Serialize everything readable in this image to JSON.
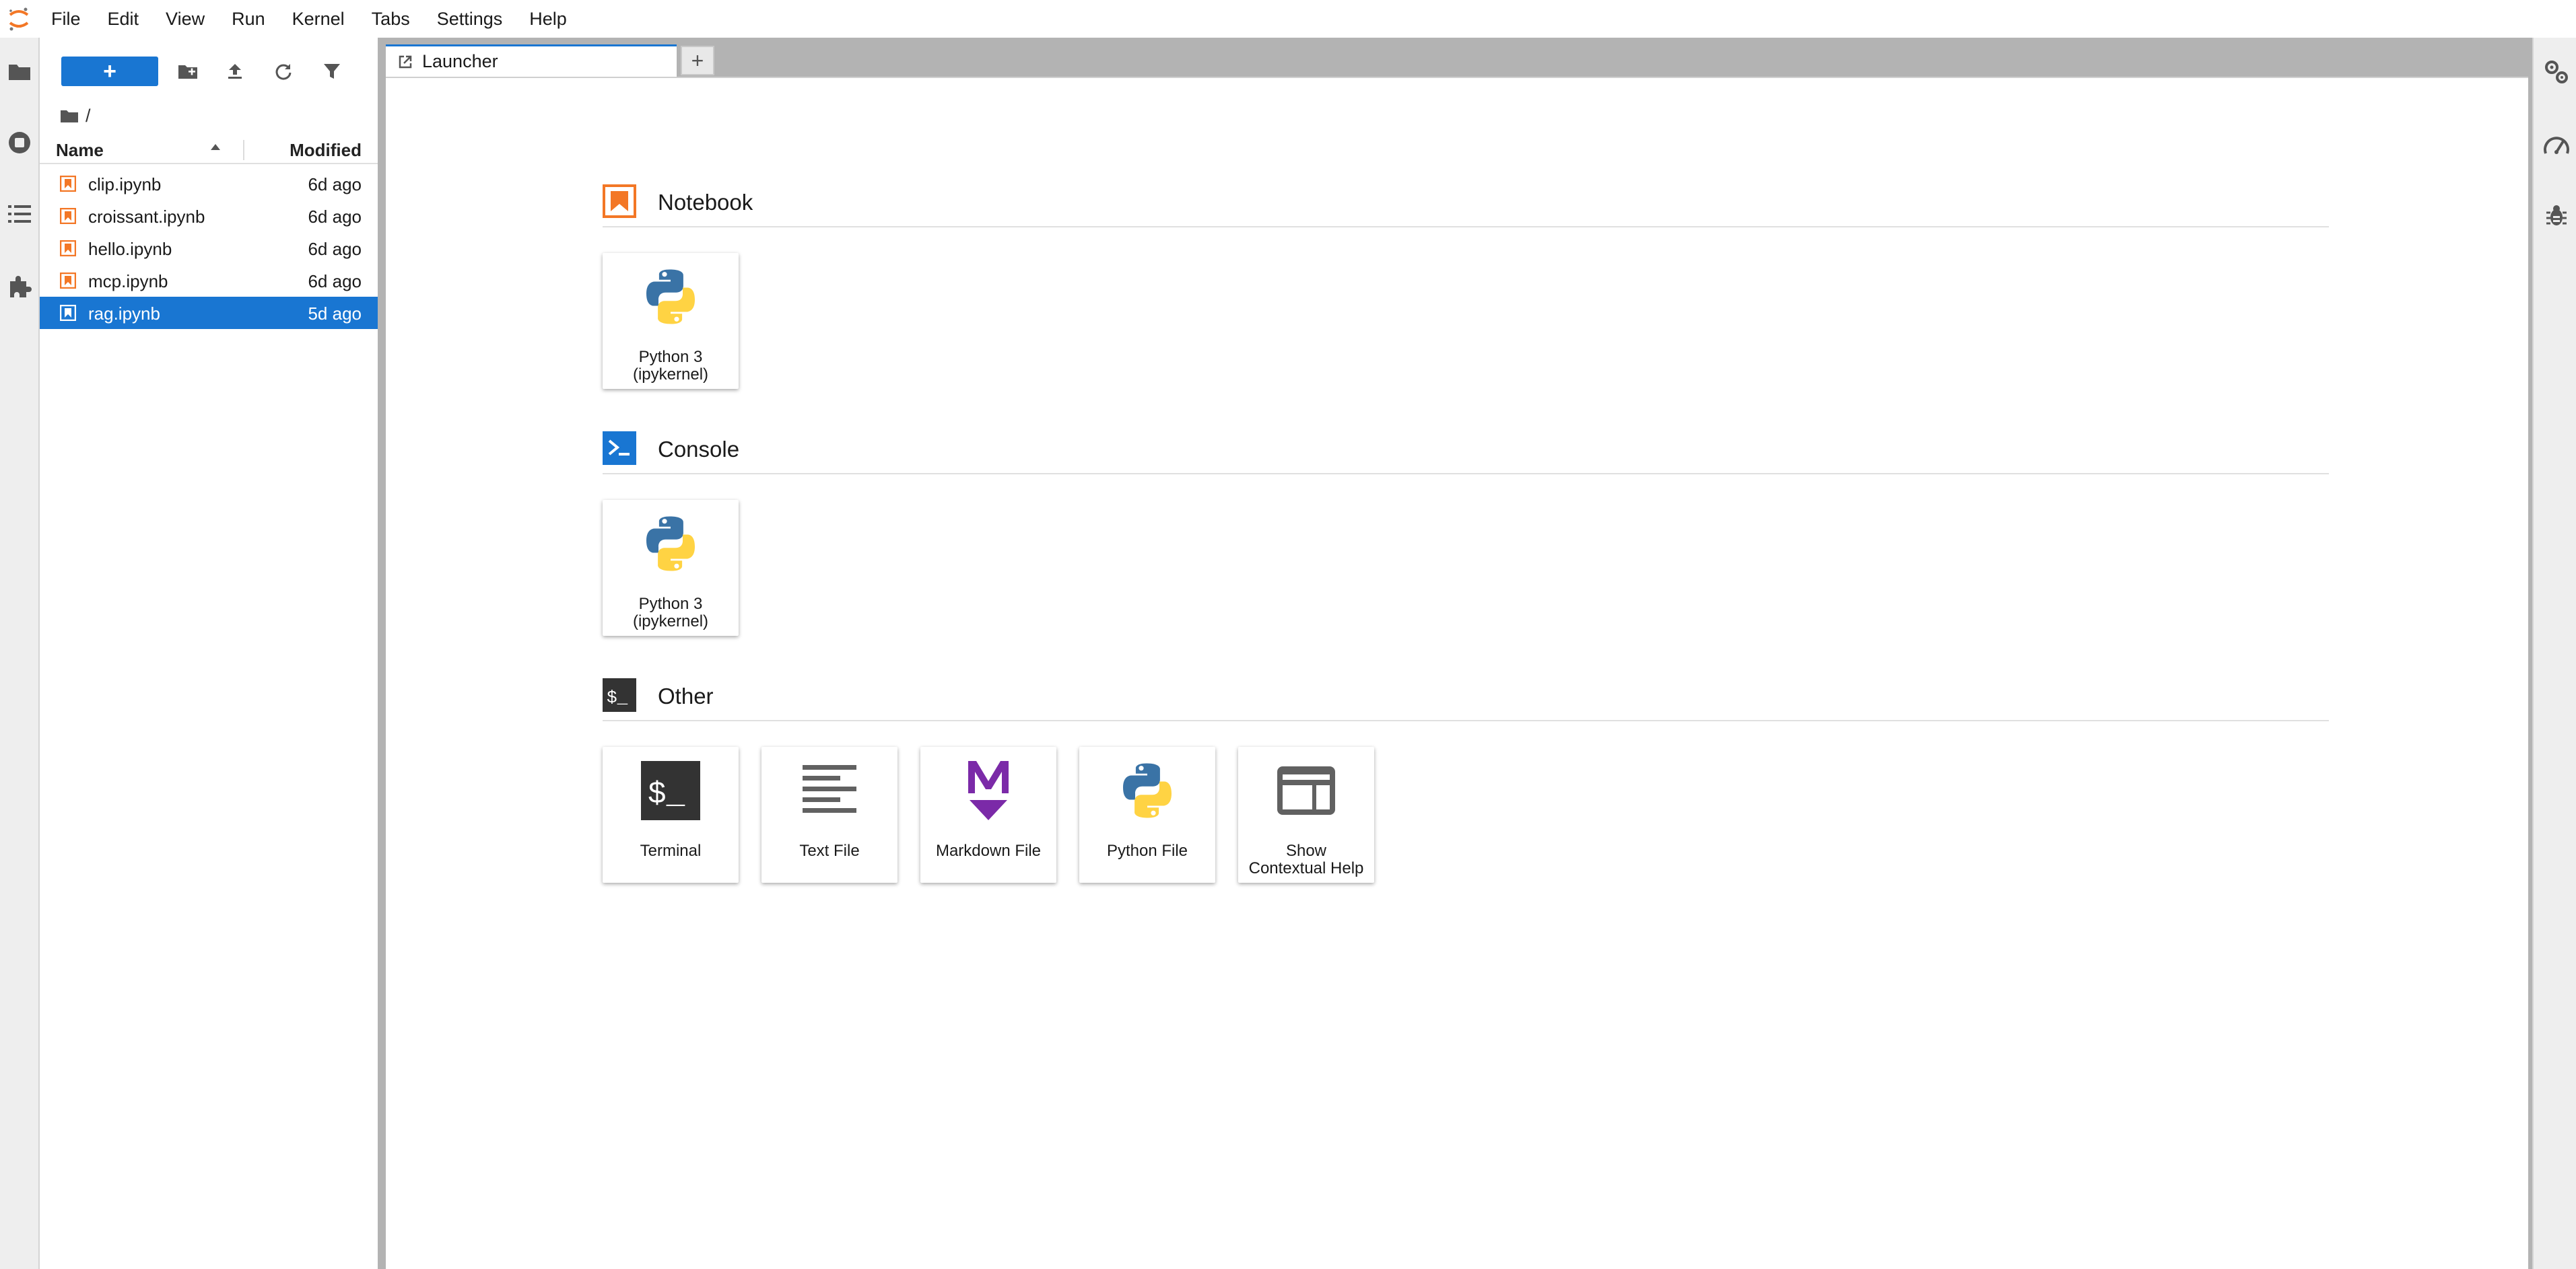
{
  "menubar": {
    "items": [
      "File",
      "Edit",
      "View",
      "Run",
      "Kernel",
      "Tabs",
      "Settings",
      "Help"
    ]
  },
  "left_activity": {
    "icons": [
      "folder-icon",
      "running-sessions-icon",
      "table-of-contents-icon",
      "extensions-icon"
    ]
  },
  "filebrowser": {
    "new_button_label": "+",
    "breadcrumb": "/",
    "columns": {
      "name": "Name",
      "modified": "Modified"
    },
    "files": [
      {
        "name": "clip.ipynb",
        "modified": "6d ago",
        "selected": false
      },
      {
        "name": "croissant.ipynb",
        "modified": "6d ago",
        "selected": false
      },
      {
        "name": "hello.ipynb",
        "modified": "6d ago",
        "selected": false
      },
      {
        "name": "mcp.ipynb",
        "modified": "6d ago",
        "selected": false
      },
      {
        "name": "rag.ipynb",
        "modified": "5d ago",
        "selected": true
      }
    ]
  },
  "tabs": {
    "active_label": "Launcher",
    "add_label": "+"
  },
  "launcher": {
    "sections": [
      {
        "title": "Notebook",
        "cards": [
          {
            "label": "Python 3\n(ipykernel)",
            "icon": "python-icon"
          }
        ]
      },
      {
        "title": "Console",
        "cards": [
          {
            "label": "Python 3\n(ipykernel)",
            "icon": "python-icon"
          }
        ]
      },
      {
        "title": "Other",
        "cards": [
          {
            "label": "Terminal",
            "icon": "terminal-icon"
          },
          {
            "label": "Text File",
            "icon": "text-file-icon"
          },
          {
            "label": "Markdown File",
            "icon": "markdown-icon"
          },
          {
            "label": "Python File",
            "icon": "python-icon"
          },
          {
            "label": "Show\nContextual Help",
            "icon": "contextual-help-icon"
          }
        ]
      }
    ]
  },
  "right_activity": {
    "icons": [
      "property-inspector-icon",
      "resource-usage-icon",
      "debugger-icon"
    ]
  },
  "colors": {
    "accent": "#1976d2",
    "notebook_orange": "#f37726",
    "python_blue": "#3a73a6",
    "python_yellow": "#ffd343",
    "markdown_purple": "#7b2aa8",
    "dock_gray": "#b3b3b3"
  }
}
